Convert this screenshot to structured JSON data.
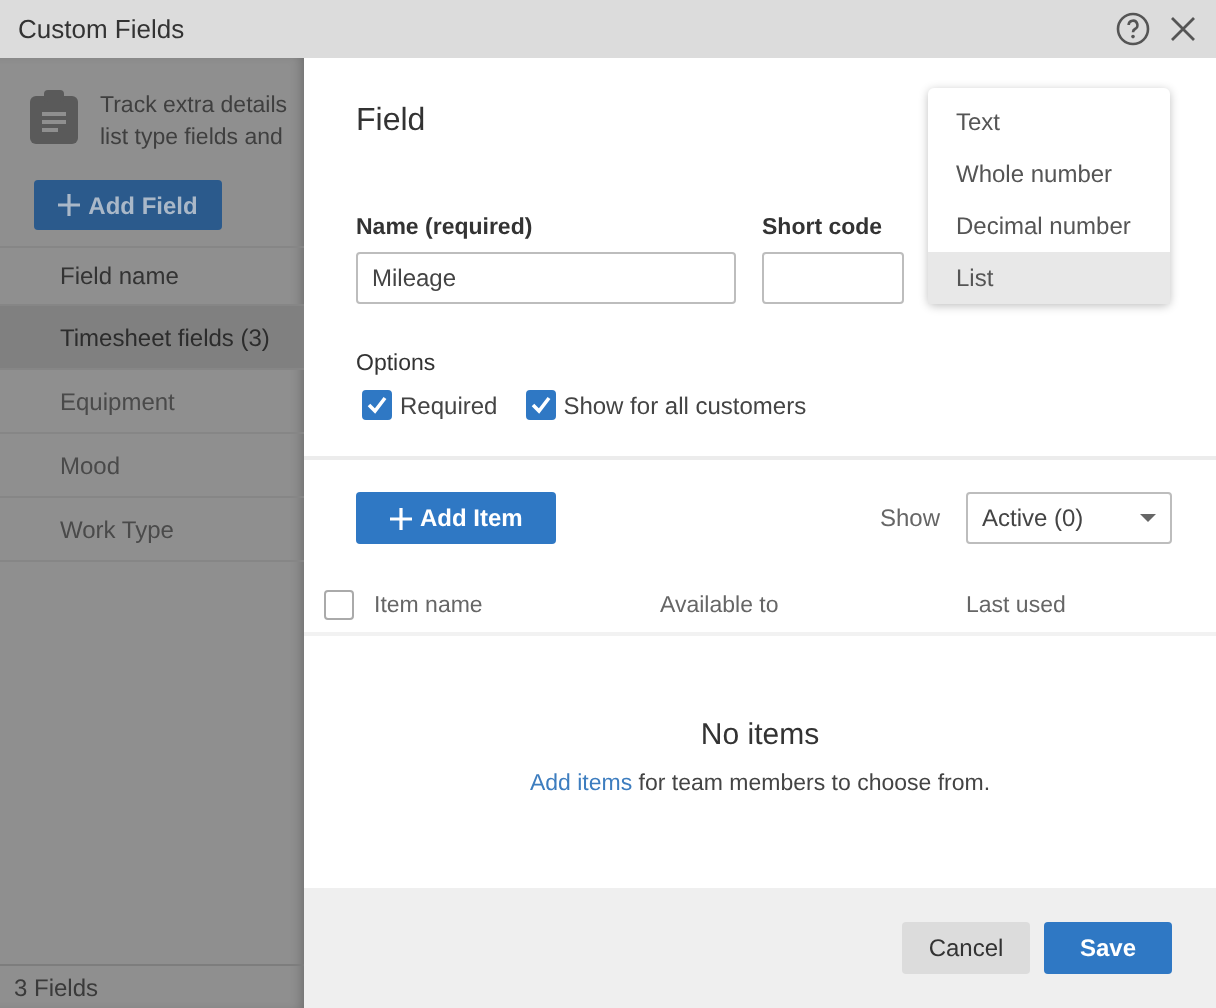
{
  "window": {
    "title": "Custom Fields"
  },
  "background_panel": {
    "description": [
      "Track extra details",
      "list type fields and"
    ],
    "add_button": "Add Field",
    "column_header": "Field name",
    "rows": [
      {
        "label": "Timesheet fields (3)",
        "selected": true
      },
      {
        "label": "Equipment",
        "selected": false
      },
      {
        "label": "Mood",
        "selected": false
      },
      {
        "label": "Work Type",
        "selected": false
      }
    ],
    "footer": "3 Fields"
  },
  "field_dialog": {
    "title": "Field",
    "name": {
      "label": "Name (required)",
      "value": "Mileage"
    },
    "short_code": {
      "label": "Short code"
    },
    "options": {
      "label": "Options",
      "items": [
        {
          "label": "Required",
          "checked": true
        },
        {
          "label": "Show for all customers",
          "checked": true
        }
      ]
    },
    "add_item_button": "Add Item",
    "show": {
      "label": "Show",
      "value": "Active (0)"
    },
    "table": {
      "select_all_checked": false,
      "columns": [
        "Item name",
        "Available to",
        "Last used"
      ]
    },
    "empty_state": {
      "title": "No items",
      "link": "Add items",
      "text": "for team members to choose from."
    },
    "buttons": [
      {
        "label": "Cancel",
        "kind": "secondary"
      },
      {
        "label": "Save",
        "kind": "primary"
      }
    ]
  },
  "type_menu": {
    "items": [
      {
        "label": "Text",
        "selected": false
      },
      {
        "label": "Whole number",
        "selected": false
      },
      {
        "label": "Decimal number",
        "selected": false
      },
      {
        "label": "List",
        "selected": true
      }
    ]
  }
}
